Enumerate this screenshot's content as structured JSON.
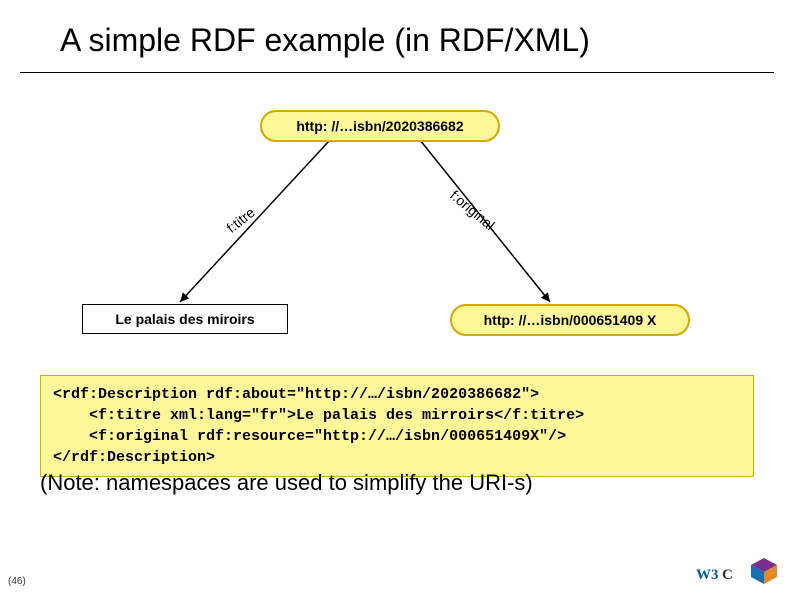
{
  "title": "A simple RDF example (in RDF/XML)",
  "graph": {
    "top_node": "http: //…isbn/2020386682",
    "right_node": "http: //…isbn/000651409 X",
    "left_node": "Le palais des miroirs",
    "edge_titre": "f:titre",
    "edge_original": "f:original"
  },
  "code": "<rdf:Description rdf:about=\"http://…/isbn/2020386682\">\n    <f:titre xml:lang=\"fr\">Le palais des mirroirs</f:titre>\n    <f:original rdf:resource=\"http://…/isbn/000651409X\"/>\n</rdf:Description>",
  "note": "(Note: namespaces are used to simplify the URI-s)",
  "pagenum": "(46)",
  "logos": {
    "w3c": "W3C",
    "sw": "Semantic Web"
  }
}
